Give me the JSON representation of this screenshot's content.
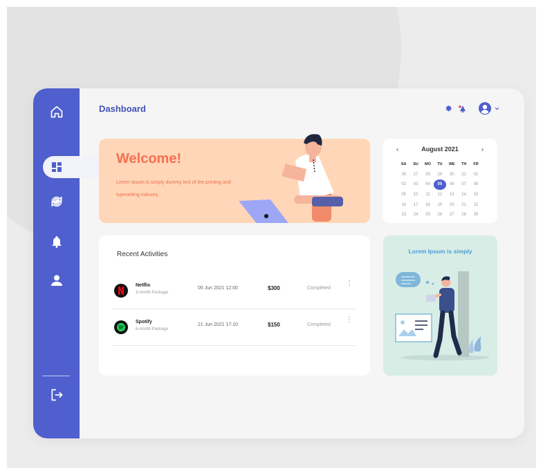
{
  "header": {
    "title": "Dashboard"
  },
  "sidebar": {
    "items": [
      {
        "name": "home",
        "icon": "home-icon"
      },
      {
        "name": "dashboard",
        "icon": "dashboard-icon",
        "active": true
      },
      {
        "name": "sync",
        "icon": "sync-icon"
      },
      {
        "name": "notifications",
        "icon": "bell-icon"
      },
      {
        "name": "profile",
        "icon": "user-icon"
      },
      {
        "name": "logout",
        "icon": "logout-icon"
      }
    ]
  },
  "welcome": {
    "heading": "Welcome!",
    "text": "Lorem Ipsum is simply dummy text of the printing and typesetting industry."
  },
  "calendar": {
    "month": "August 2021",
    "prev": "‹",
    "next": "›",
    "weekdays": [
      "SA",
      "SU",
      "MO",
      "TU",
      "WE",
      "TH",
      "FR"
    ],
    "days": [
      "26",
      "27",
      "28",
      "29",
      "30",
      "31",
      "01",
      "02",
      "03",
      "04",
      "05",
      "06",
      "07",
      "08",
      "09",
      "10",
      "11",
      "12",
      "13",
      "14",
      "15",
      "16",
      "17",
      "18",
      "19",
      "20",
      "21",
      "22",
      "23",
      "24",
      "25",
      "26",
      "27",
      "28",
      "29"
    ],
    "selected": "05"
  },
  "activities": {
    "title": "Recent Activities",
    "rows": [
      {
        "name": "Netflix",
        "plan": "3-month Package",
        "date": "05 Jun 2021 12:00",
        "amount": "$300",
        "status": "Completed"
      },
      {
        "name": "Spotify",
        "plan": "6-month Package",
        "date": "21 Jun 2021 17:10",
        "amount": "$150",
        "status": "Completed"
      }
    ],
    "more": "⋮"
  },
  "promo": {
    "title": "Lorem Ipsum is simply"
  },
  "colors": {
    "accent": "#4f5fcd",
    "welcome_bg": "#ffd6b8",
    "welcome_text": "#f5704f",
    "promo_bg": "#d7ede6"
  }
}
